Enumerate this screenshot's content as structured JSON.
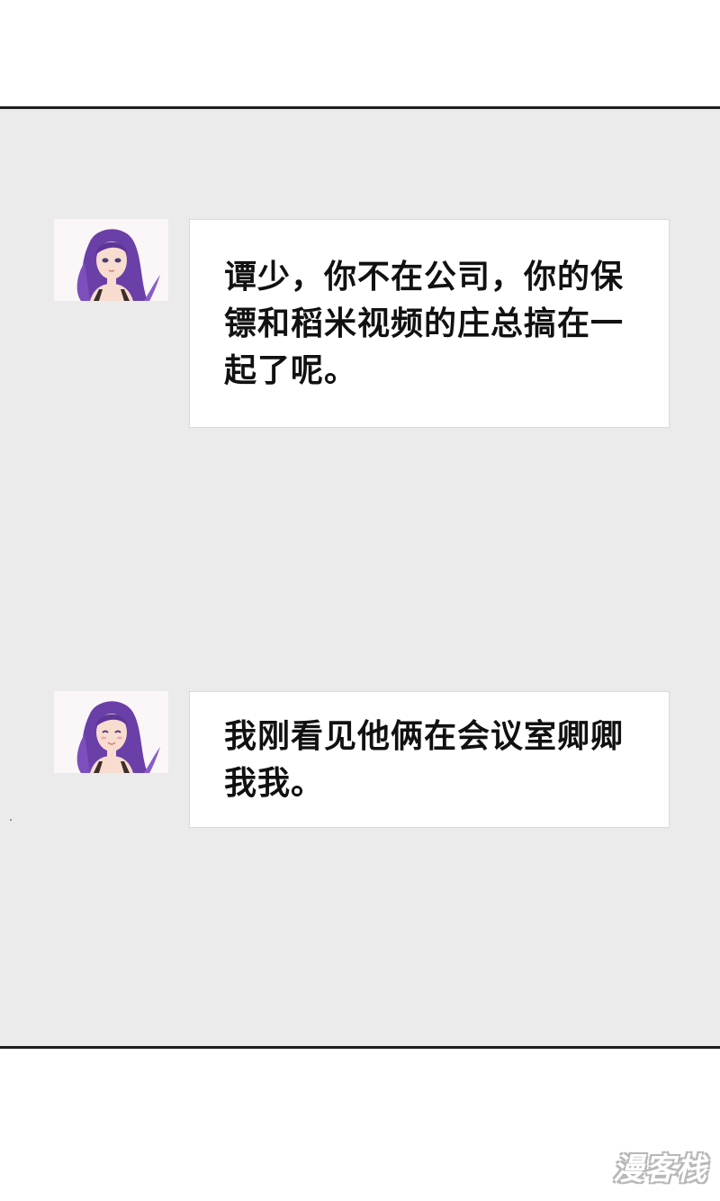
{
  "messages": [
    {
      "sender_avatar": "purple-haired-girl-avatar",
      "text": "谭少，你不在公司，你的保镖和稻米视频的庄总搞在一起了呢。"
    },
    {
      "sender_avatar": "purple-haired-girl-avatar",
      "text": "我刚看见他俩在会议室卿卿我我。"
    }
  ],
  "watermark": {
    "text": "漫客栈"
  },
  "colors": {
    "panel_bg": "#ebebeb",
    "bubble_bg": "#ffffff",
    "border": "#1e1e1e",
    "text": "#111111",
    "hair": "#6a3fa8"
  }
}
